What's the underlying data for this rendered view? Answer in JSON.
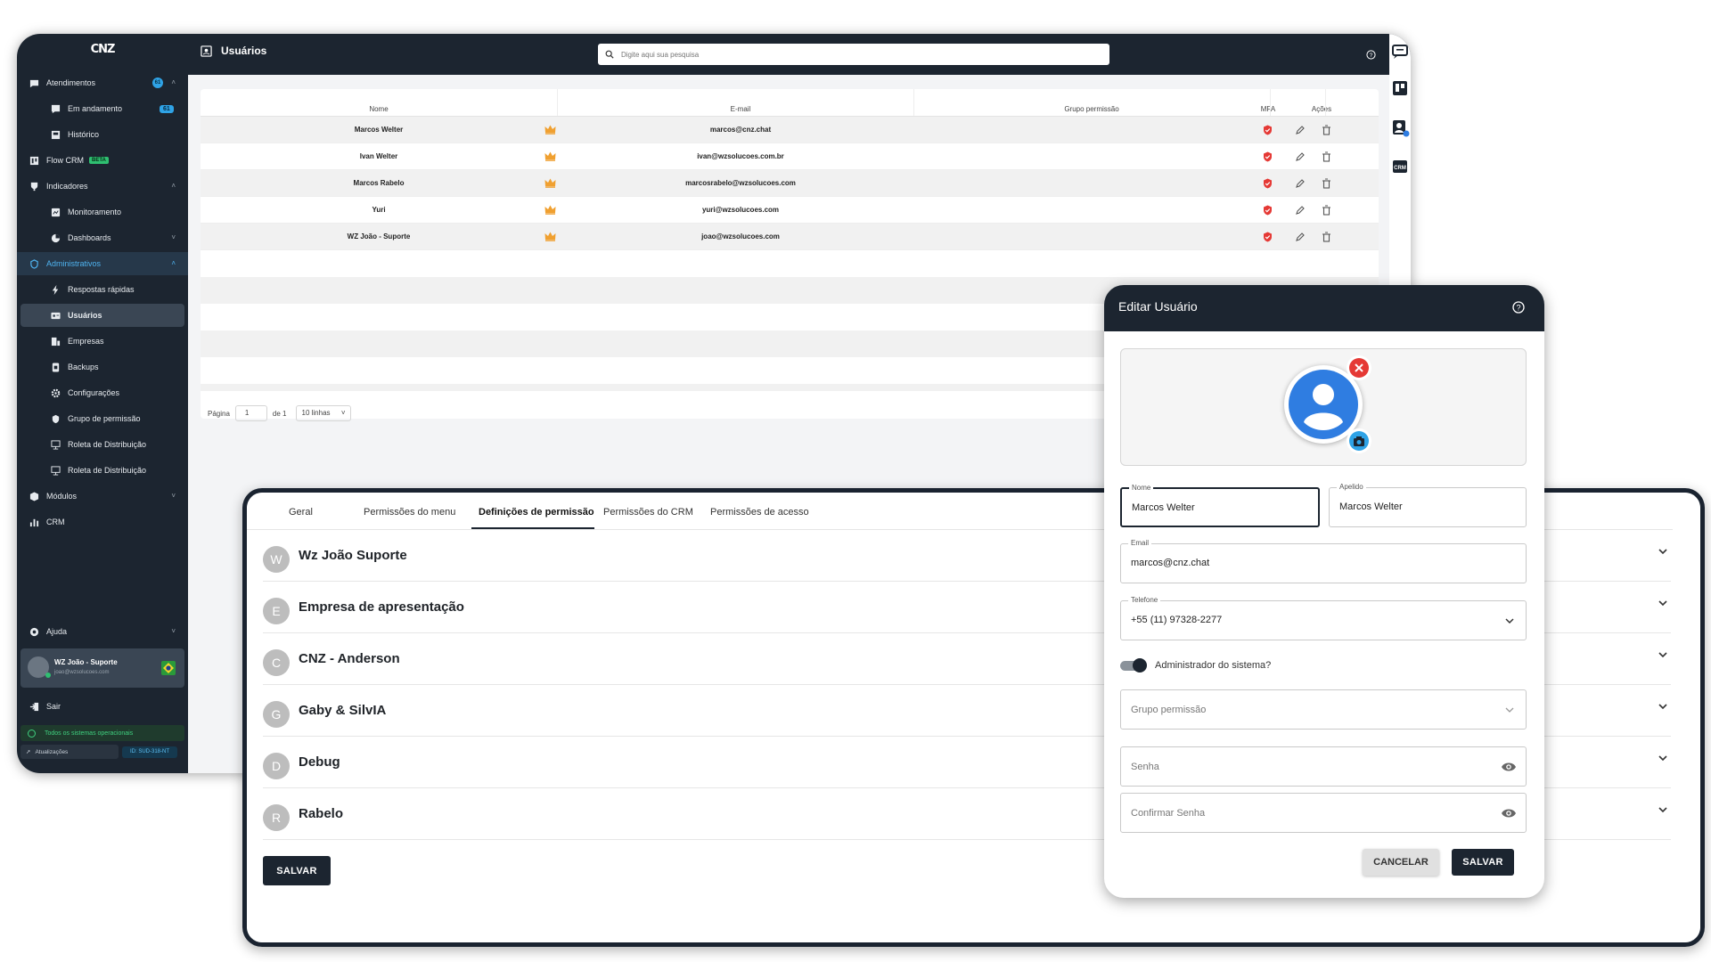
{
  "sidebar": {
    "brand": "CNZ",
    "items": [
      {
        "label": "Atendimentos",
        "count": "61"
      },
      {
        "label": "Em andamento",
        "badge": "61"
      },
      {
        "label": "Histórico"
      },
      {
        "label": "Flow CRM",
        "tag": "BETA"
      },
      {
        "label": "Indicadores"
      },
      {
        "label": "Monitoramento"
      },
      {
        "label": "Dashboards"
      },
      {
        "label": "Administrativos"
      },
      {
        "label": "Respostas rápidas"
      },
      {
        "label": "Usuários"
      },
      {
        "label": "Empresas"
      },
      {
        "label": "Backups"
      },
      {
        "label": "Configurações"
      },
      {
        "label": "Grupo de permissão"
      },
      {
        "label": "Roleta de Distribuição"
      },
      {
        "label": "Roleta de Distribuição"
      },
      {
        "label": "Módulos"
      },
      {
        "label": "CRM"
      }
    ],
    "help": "Ajuda",
    "user_name": "WZ João - Suporte",
    "user_email": "joao@wzsolucoes.com",
    "logout": "Sair",
    "status": "Todos os sistemas operacionais",
    "updates": "Atualizações",
    "id_label": "ID: SUD-318-NT"
  },
  "header": {
    "title": "Usuários",
    "search_placeholder": "Digite aqui sua pesquisa"
  },
  "table": {
    "columns": [
      "Nome",
      "E-mail",
      "Grupo permissão",
      "MFA",
      "Ações"
    ],
    "rows": [
      {
        "name": "Marcos Welter",
        "email": "marcos@cnz.chat"
      },
      {
        "name": "Ivan Welter",
        "email": "ivan@wzsolucoes.com.br"
      },
      {
        "name": "Marcos Rabelo",
        "email": "marcosrabelo@wzsolucoes.com"
      },
      {
        "name": "Yuri",
        "email": "yuri@wzsolucoes.com"
      },
      {
        "name": "WZ João - Suporte",
        "email": "joao@wzsolucoes.com"
      }
    ],
    "pager": {
      "label": "Página",
      "page": "1",
      "of": "de 1",
      "rows": "10 linhas"
    }
  },
  "permissions": {
    "tabs": [
      "Geral",
      "Permissões do menu",
      "Definições de permissão",
      "Permissões do CRM",
      "Permissões de acesso"
    ],
    "active_tab": 2,
    "groups": [
      {
        "initial": "W",
        "name": "Wz João Suporte"
      },
      {
        "initial": "E",
        "name": "Empresa de apresentação"
      },
      {
        "initial": "C",
        "name": "CNZ - Anderson"
      },
      {
        "initial": "G",
        "name": "Gaby & SilvIA"
      },
      {
        "initial": "D",
        "name": "Debug"
      },
      {
        "initial": "R",
        "name": "Rabelo"
      }
    ],
    "save_label": "SALVAR"
  },
  "modal": {
    "title": "Editar Usuário",
    "fields": {
      "nome_label": "Nome",
      "nome_value": "Marcos Welter",
      "apelido_label": "Apelido",
      "apelido_value": "Marcos Welter",
      "email_label": "Email",
      "email_value": "marcos@cnz.chat",
      "telefone_label": "Telefone",
      "telefone_value": "+55 (11) 97328-2277",
      "admin_label": "Administrador do sistema?",
      "grupo_placeholder": "Grupo permissão",
      "senha_placeholder": "Senha",
      "confirmar_placeholder": "Confirmar Senha"
    },
    "admin_enabled": true,
    "cancel_label": "CANCELAR",
    "save_label": "SALVAR"
  },
  "colors": {
    "dark": "#1c2530",
    "accent": "#2fa3e6",
    "crown": "#f0a030",
    "mfa": "#e53935"
  }
}
